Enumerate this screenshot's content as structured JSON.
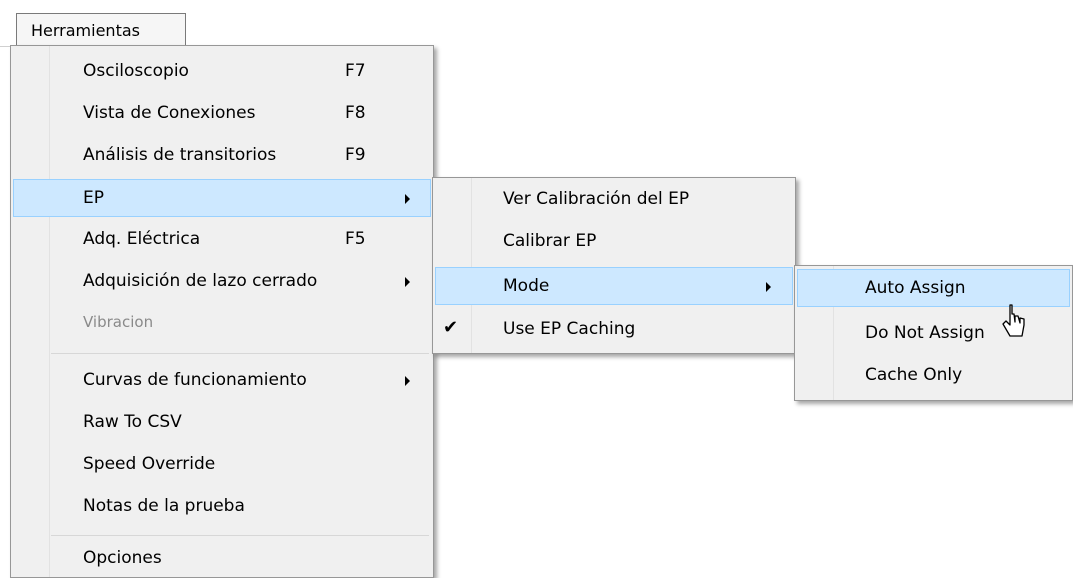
{
  "menubar": {
    "tab_label": "Herramientas"
  },
  "main_menu": {
    "items": [
      {
        "label": "Osciloscopio",
        "shortcut": "F7"
      },
      {
        "label": "Vista de Conexiones",
        "shortcut": "F8"
      },
      {
        "label": "Análisis de transitorios",
        "shortcut": "F9"
      },
      {
        "label": "EP",
        "submenu": true
      },
      {
        "label": "Adq. Eléctrica",
        "shortcut": "F5"
      },
      {
        "label": "Adquisición de lazo cerrado",
        "submenu": true
      },
      {
        "label": "Vibracion",
        "disabled": true
      },
      {
        "label": "Curvas de funcionamiento",
        "submenu": true
      },
      {
        "label": "Raw To CSV"
      },
      {
        "label": "Speed Override"
      },
      {
        "label": "Notas de la prueba"
      },
      {
        "label": "Opciones"
      }
    ]
  },
  "ep_menu": {
    "items": [
      {
        "label": "Ver Calibración del EP"
      },
      {
        "label": "Calibrar EP"
      },
      {
        "label": "Mode",
        "submenu": true
      },
      {
        "label": "Use EP Caching",
        "checked": true
      }
    ]
  },
  "mode_menu": {
    "items": [
      {
        "label": "Auto Assign"
      },
      {
        "label": "Do Not Assign"
      },
      {
        "label": "Cache Only"
      }
    ]
  },
  "colors": {
    "highlight": "#cde8ff",
    "highlight_border": "#99d1ff",
    "menu_bg": "#f0f0f0"
  },
  "icons": {
    "check": "checkmark-icon",
    "submenu": "chevron-right-icon",
    "cursor": "mouse-pointer-icon"
  }
}
